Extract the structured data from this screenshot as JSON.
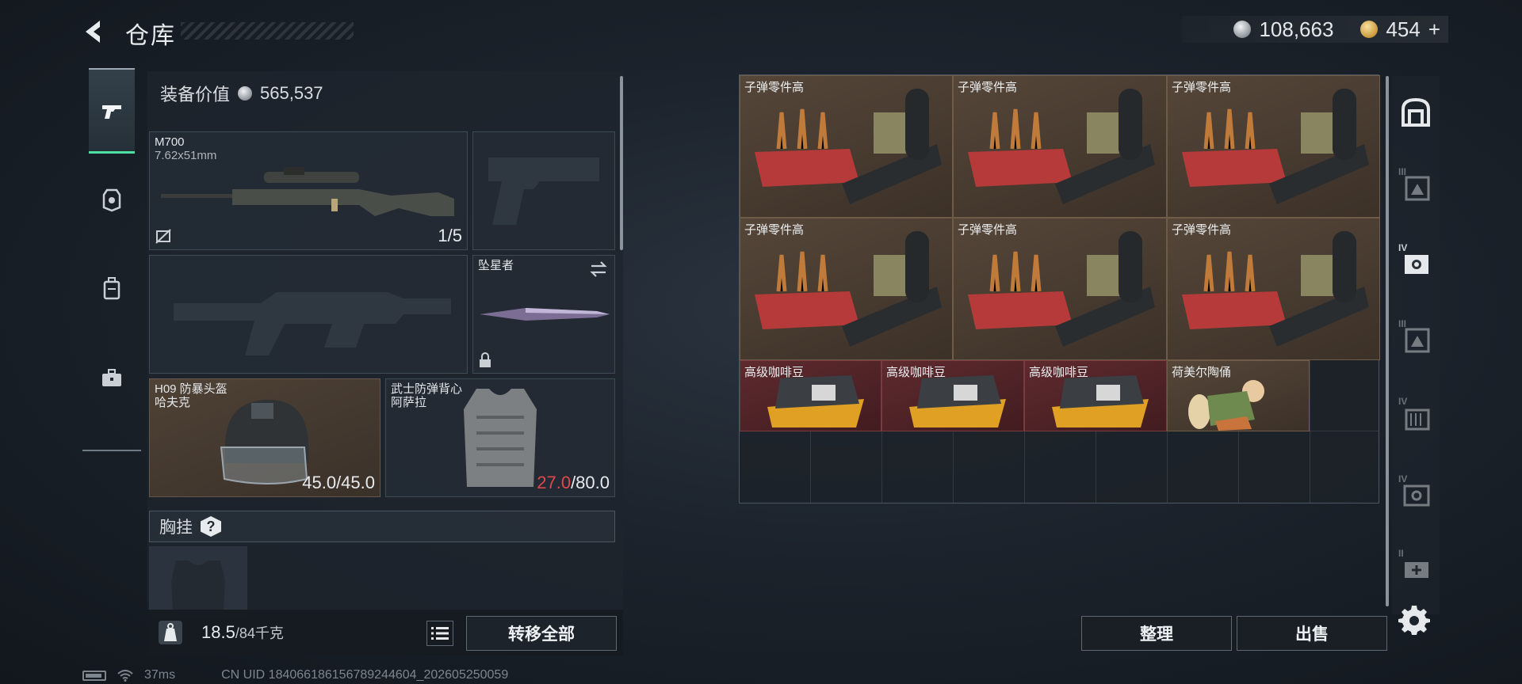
{
  "header": {
    "title": "仓库",
    "currency": [
      {
        "icon": "silver-coin-icon",
        "value": "108,663"
      },
      {
        "icon": "gold-coin-icon",
        "value": "454"
      }
    ],
    "add_label": "+"
  },
  "left_tabs": [
    {
      "icon": "pistol-icon",
      "active": true
    },
    {
      "icon": "armor-icon",
      "active": false
    },
    {
      "icon": "backpack-icon",
      "active": false
    },
    {
      "icon": "briefcase-icon",
      "active": false
    }
  ],
  "loadout": {
    "value_label": "装备价值",
    "value": "565,537",
    "primary_weapon": {
      "name": "M700",
      "caliber": "7.62x51mm",
      "count": "1/5"
    },
    "melee": {
      "name": "坠星者"
    },
    "helmet": {
      "name": "H09 防暴头盔",
      "brand": "哈夫克",
      "durability": "45.0/45.0"
    },
    "armor": {
      "name": "武士防弹背心",
      "brand": "阿萨拉",
      "durability_current": "27.0",
      "durability_max": "/80.0"
    },
    "chest_rig_label": "胸挂",
    "chest_rig_help": "?",
    "weight_value": "18.5",
    "weight_max": "/84千克",
    "transfer_all": "转移全部"
  },
  "status": {
    "ping": "37ms",
    "uid": "CN UID 1840661861567892446​04_202605250059"
  },
  "storage": {
    "items": [
      {
        "label": "子弹零件高",
        "kind": "ammo-parts"
      },
      {
        "label": "子弹零件高",
        "kind": "ammo-parts"
      },
      {
        "label": "子弹零件高",
        "kind": "ammo-parts"
      },
      {
        "label": "子弹零件高",
        "kind": "ammo-parts"
      },
      {
        "label": "子弹零件高",
        "kind": "ammo-parts"
      },
      {
        "label": "子弹零件高",
        "kind": "ammo-parts"
      },
      {
        "label": "高级咖啡豆",
        "kind": "coffee"
      },
      {
        "label": "高级咖啡豆",
        "kind": "coffee"
      },
      {
        "label": "高级咖啡豆",
        "kind": "coffee"
      },
      {
        "label": "荷美尔陶俑",
        "kind": "figurine"
      }
    ],
    "sort_label": "整理",
    "sell_label": "出售"
  },
  "right_categories": [
    {
      "icon": "vault-icon",
      "tier": ""
    },
    {
      "icon": "container-iii-icon",
      "tier": "III"
    },
    {
      "icon": "safe-iv-icon",
      "tier": "IV"
    },
    {
      "icon": "container-iii-b-icon",
      "tier": "III"
    },
    {
      "icon": "crate-iv-icon",
      "tier": "IV"
    },
    {
      "icon": "safe-iv-b-icon",
      "tier": "IV"
    },
    {
      "icon": "medkit-icon",
      "tier": "II"
    }
  ],
  "colors": {
    "accent": "#4ee0a0",
    "durability_low": "#e0474c",
    "item_brown": "#554638",
    "item_red": "#5e2a2e"
  }
}
